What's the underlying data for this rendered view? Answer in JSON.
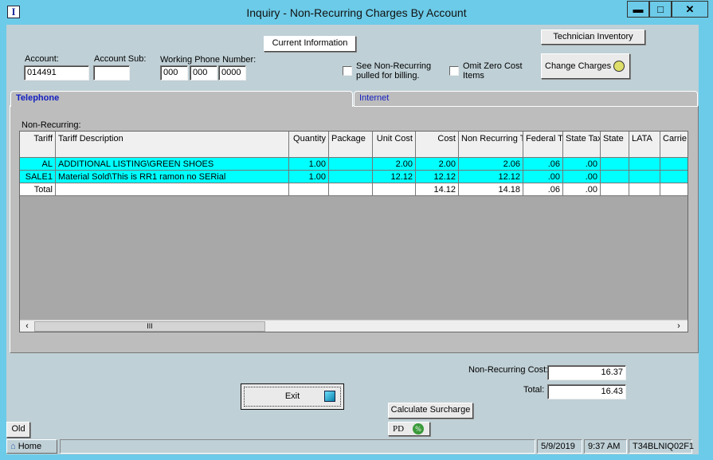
{
  "window": {
    "title": "Inquiry - Non-Recurring Charges By Account",
    "minimize": "▬",
    "maximize": "□",
    "close": "✕",
    "app_icon": "I"
  },
  "header": {
    "current_information": "Current Information",
    "technician_inventory": "Technician Inventory",
    "change_charges": "Change Charges",
    "account_label": "Account:",
    "account_value": "014491",
    "account_sub_label": "Account Sub:",
    "account_sub_value": "",
    "phone_label": "Working Phone Number:",
    "phone": [
      "000",
      "000",
      "0000"
    ],
    "see_nonrecurring": "See Non-Recurring pulled for billing.",
    "see_nonrecurring_checked": false,
    "omit_zero": "Omit Zero Cost Items",
    "omit_zero_checked": false
  },
  "tabs": [
    {
      "label": "Telephone",
      "active": true
    },
    {
      "label": "Internet",
      "active": false
    }
  ],
  "grid": {
    "label": "Non-Recurring:",
    "columns": [
      "Tariff",
      "Tariff Description",
      "Quantity",
      "Package",
      "Unit Cost",
      "Cost",
      "Non Recurring Total",
      "Federal Tax",
      "State Tax",
      "State",
      "LATA",
      "Carrie"
    ],
    "rows": [
      [
        "AL",
        "ADDITIONAL LISTING\\GREEN SHOES",
        "1.00",
        "",
        "2.00",
        "2.00",
        "2.06",
        ".06",
        ".00",
        "",
        "",
        ""
      ],
      [
        "SALE1",
        "Material Sold\\This is  RR1  ramon no SERial",
        "1.00",
        "",
        "12.12",
        "12.12",
        "12.12",
        ".00",
        ".00",
        "",
        "",
        ""
      ],
      [
        "Total",
        "",
        "",
        "",
        "",
        "14.12",
        "14.18",
        ".06",
        ".00",
        "",
        "",
        ""
      ]
    ],
    "highlight_color": "#00ffff"
  },
  "summary": {
    "nr_cost_label": "Non-Recurring Cost:",
    "nr_cost": "16.37",
    "total_label": "Total:",
    "total": "16.43"
  },
  "buttons": {
    "exit": "Exit",
    "calculate_surcharge": "Calculate Surcharge",
    "pd": "PD",
    "old": "Old"
  },
  "statusbar": {
    "home": "Home",
    "date": "5/9/2019",
    "time": "9:37 AM",
    "code": "T34BLNIQ02F1"
  }
}
